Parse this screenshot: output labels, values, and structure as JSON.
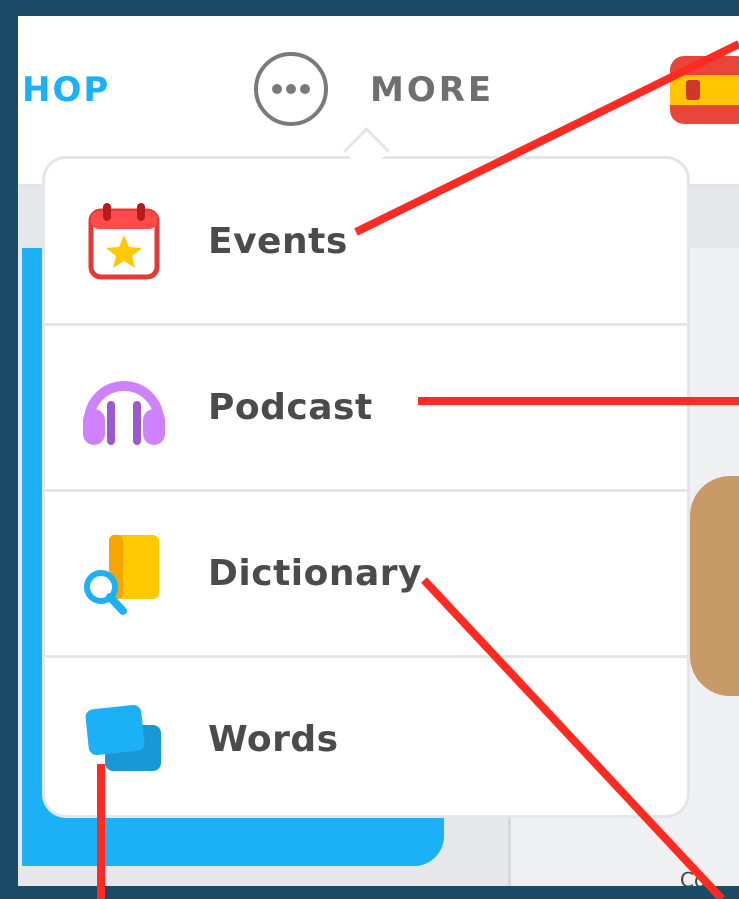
{
  "top_nav": {
    "shop_label": "HOP",
    "more_label": "MORE",
    "more_icon": "ellipsis-icon",
    "flag_icon": "spain-flag-icon"
  },
  "dropdown": {
    "items": [
      {
        "label": "Events",
        "icon": "calendar-star-icon"
      },
      {
        "label": "Podcast",
        "icon": "headphones-icon"
      },
      {
        "label": "Dictionary",
        "icon": "book-search-icon"
      },
      {
        "label": "Words",
        "icon": "flashcards-icon"
      }
    ]
  },
  "background": {
    "fragment_text": "Co"
  },
  "colors": {
    "accent_blue": "#1cb0f6",
    "annotation_red": "#ff2a22",
    "frame": "#1b4b67",
    "label_text": "#4b4b4b"
  }
}
